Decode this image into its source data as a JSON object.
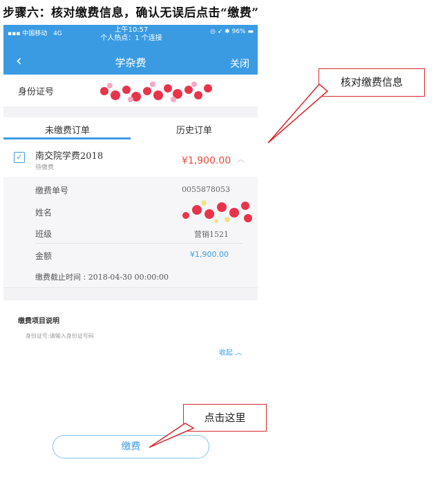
{
  "heading": "步骤六：核对缴费信息，确认无误后点击“缴费”",
  "status_bar": {
    "carrier": "中国移动",
    "network": "4G",
    "time": "上午10:57",
    "hotspot": "个人热点：1 个连接",
    "battery": "96%"
  },
  "nav": {
    "back_icon": "chevron-left-icon",
    "title": "学杂费",
    "close_label": "关闭"
  },
  "id_row": {
    "label": "身份证号"
  },
  "tabs": [
    {
      "label": "未缴费订单",
      "active": true
    },
    {
      "label": "历史订单",
      "active": false
    }
  ],
  "order": {
    "title": "南交院学费2018",
    "status": "待缴费",
    "amount": "¥1,900.00",
    "checked": true
  },
  "details": {
    "bill_no_label": "缴费单号",
    "bill_no": "0055878053",
    "name_label": "姓名",
    "class_label": "班级",
    "class_value": "营销1521",
    "amount_label": "金额",
    "amount_value": "¥1,900.00",
    "deadline_label": "缴费截止时间",
    "deadline_value": "2018-04-30 00:00:00"
  },
  "description": {
    "title": "缴费项目说明",
    "text": "身份证号:请输入身份证号码",
    "collapse_label": "收起"
  },
  "pay_button": "缴费",
  "callouts": {
    "verify": "核对缴费信息",
    "click_here": "点击这里"
  },
  "colors": {
    "accent": "#3a9be3",
    "price": "#e84d3d",
    "callout_border": "#d9262a"
  }
}
